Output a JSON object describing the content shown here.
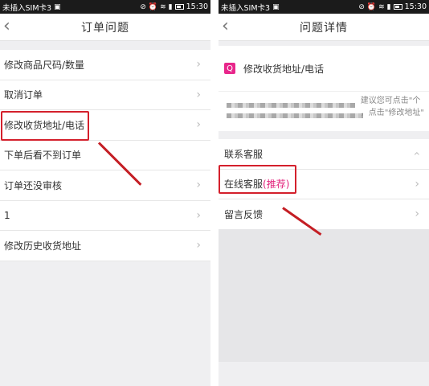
{
  "status_bar": {
    "carrier": "未插入SIM卡3",
    "time": "15:30"
  },
  "left_screen": {
    "title": "订单问题",
    "items": [
      {
        "label": "修改商品尺码/数量"
      },
      {
        "label": "取消订单"
      },
      {
        "label": "修改收货地址/电话"
      },
      {
        "label": "下单后看不到订单"
      },
      {
        "label": "订单还没审核"
      },
      {
        "label": "1"
      },
      {
        "label": "修改历史收货地址"
      }
    ]
  },
  "right_screen": {
    "title": "问题详情",
    "topic_badge": "Q",
    "topic": "修改收货地址/电话",
    "answer_line1": "建议您可点击\"个",
    "answer_line2": "，点击\"修改地址\"",
    "contact_header": "联系客服",
    "online_service": "在线客服",
    "online_service_tag": "(推荐)",
    "message_feedback": "留言反馈"
  },
  "colors": {
    "highlight": "#d4202c",
    "accent": "#e8268b",
    "background": "#efeff1"
  }
}
